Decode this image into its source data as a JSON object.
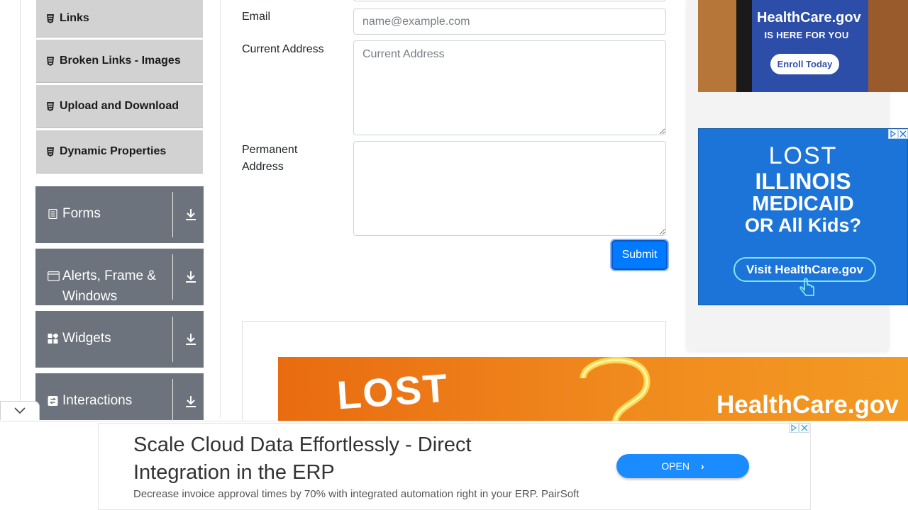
{
  "sidebar": {
    "elements_items": [
      {
        "label": "Links"
      },
      {
        "label": "Broken Links - Images"
      },
      {
        "label": "Upload and Download"
      },
      {
        "label": "Dynamic Properties"
      }
    ],
    "groups": [
      {
        "label": "Forms",
        "icon": "document-icon"
      },
      {
        "label": "Alerts, Frame & Windows",
        "icon": "window-icon"
      },
      {
        "label": "Widgets",
        "icon": "widgets-icon"
      },
      {
        "label": "Interactions",
        "icon": "interactions-icon"
      }
    ]
  },
  "form": {
    "email_label": "Email",
    "email_placeholder": "name@example.com",
    "current_address_label": "Current Address",
    "current_address_placeholder": "Current Address",
    "permanent_address_label": "Permanent Address",
    "submit_label": "Submit"
  },
  "ads": {
    "side_top": {
      "brand": "HealthCare.gov",
      "tagline": "IS HERE FOR YOU",
      "button": "Enroll Today"
    },
    "side_middle": {
      "lines": [
        "LOST",
        "ILLINOIS",
        "MEDICAID",
        "OR All Kids?"
      ],
      "button": "Visit HealthCare.gov"
    },
    "banner": {
      "headline": "LOST",
      "brand": "HealthCare.gov"
    },
    "bottom": {
      "title": "Scale Cloud Data Effortlessly - Direct Integration in the ERP",
      "description": "Decrease invoice approval times by 70% with integrated automation right in your ERP. PairSoft",
      "button": "OPEN"
    }
  },
  "colors": {
    "group_bg": "#6c737c",
    "item_bg": "#d2d2d2",
    "primary": "#007bff",
    "ad_blue": "#1d74d8",
    "banner_orange": "#f08a1e"
  }
}
